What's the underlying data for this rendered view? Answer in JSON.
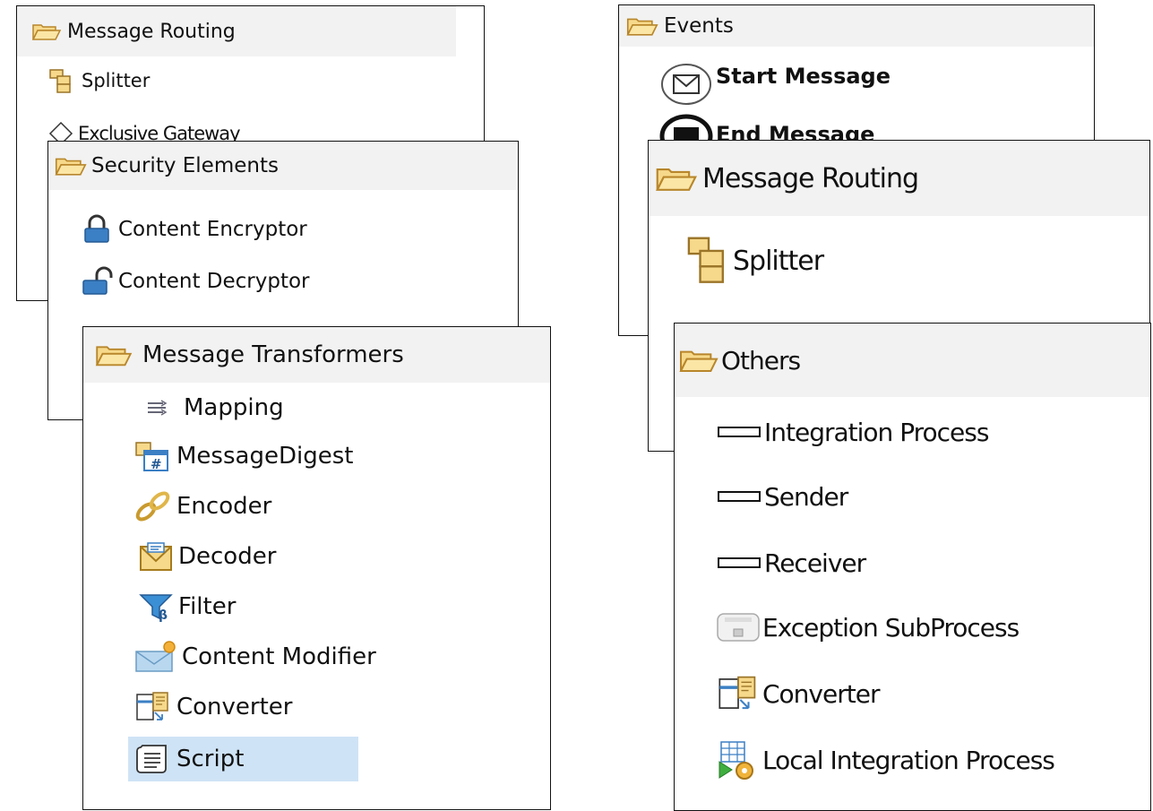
{
  "panel1": {
    "header": "Message Routing",
    "items": [
      {
        "label": "Splitter",
        "icon": "splitter-icon"
      },
      {
        "label": "Exclusive Gateway",
        "icon": "gateway-diamond-icon"
      }
    ]
  },
  "panel2": {
    "header": "Security Elements",
    "items": [
      {
        "label": "Content Encryptor",
        "icon": "lock-closed-icon"
      },
      {
        "label": "Content Decryptor",
        "icon": "lock-open-icon"
      }
    ]
  },
  "panel3": {
    "header": "Message Transformers",
    "items": [
      {
        "label": "Mapping",
        "icon": "mapping-icon"
      },
      {
        "label": "MessageDigest",
        "icon": "message-digest-icon"
      },
      {
        "label": "Encoder",
        "icon": "encoder-chain-icon"
      },
      {
        "label": "Decoder",
        "icon": "decoder-envelope-icon"
      },
      {
        "label": "Filter",
        "icon": "filter-funnel-icon"
      },
      {
        "label": "Content Modifier",
        "icon": "content-modifier-icon"
      },
      {
        "label": "Converter",
        "icon": "converter-icon"
      },
      {
        "label": "Script",
        "icon": "script-icon",
        "selected": true
      }
    ]
  },
  "panel4": {
    "header": "Events",
    "items": [
      {
        "label": "Start Message",
        "icon": "start-message-icon"
      },
      {
        "label": "End Message",
        "icon": "end-message-icon"
      }
    ]
  },
  "panel5": {
    "header": "Message Routing",
    "items": [
      {
        "label": "Splitter",
        "icon": "splitter-icon"
      }
    ]
  },
  "panel6": {
    "header": "Others",
    "items": [
      {
        "label": "Integration Process",
        "icon": "pool-icon"
      },
      {
        "label": "Sender",
        "icon": "pool-icon"
      },
      {
        "label": "Receiver",
        "icon": "pool-icon"
      },
      {
        "label": "Exception SubProcess",
        "icon": "exception-subprocess-icon"
      },
      {
        "label": "Converter",
        "icon": "converter-icon"
      },
      {
        "label": "Local Integration Process",
        "icon": "local-integration-process-icon"
      }
    ]
  },
  "colors": {
    "header_bg": "#f2f2f2",
    "selection_bg": "#cfe3f6",
    "folder_fill": "#f7d98b",
    "folder_stroke": "#b8862b",
    "lock_blue": "#3b7fc4"
  }
}
